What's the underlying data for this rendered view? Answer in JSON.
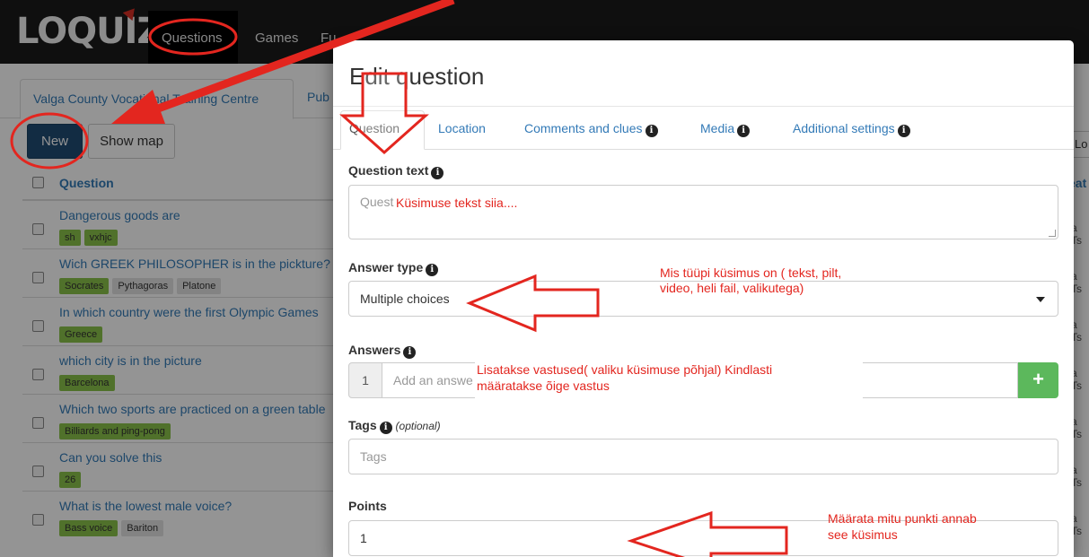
{
  "app": {
    "logo": "LOQUIZ",
    "nav": [
      "Questions",
      "Games",
      "Fu"
    ]
  },
  "background": {
    "tab_active": "Valga County Vocational Training Centre",
    "tab_other": "Pub",
    "new_button": "New",
    "show_map_button": "Show map",
    "column_header": "Question",
    "right_button": "Lo",
    "right_column_header": "eat",
    "right_cell": "a Ts",
    "rows": [
      {
        "question": "Dangerous goods are",
        "tags": [
          "sh",
          "vxhjc"
        ]
      },
      {
        "question": "Wich GREEK PHILOSOPHER is in the pickture?",
        "tags": [
          "Socrates",
          "Pythagoras",
          "Platone"
        ]
      },
      {
        "question": "In which country were the first Olympic Games",
        "tags": [
          "Greece"
        ]
      },
      {
        "question": "which city is in the picture",
        "tags": [
          "Barcelona"
        ]
      },
      {
        "question": "Which two sports are practiced on a green table",
        "tags": [
          "Billiards and ping-pong"
        ]
      },
      {
        "question": "Can you solve this",
        "tags": [
          "26"
        ]
      },
      {
        "question": "What is the lowest male voice?",
        "tags": [
          "Bass voice",
          "Bariton"
        ]
      }
    ]
  },
  "modal": {
    "title": "Edit question",
    "tabs": [
      "Question",
      "Location",
      "Comments and clues",
      "Media",
      "Additional settings"
    ],
    "question_text_label": "Question text",
    "question_text_placeholder": "Quest",
    "answer_type_label": "Answer type",
    "answer_type_value": "Multiple choices",
    "answers_label": "Answers",
    "answer_number": "1",
    "answer_placeholder": "Add an answe",
    "add_answer_icon": "+",
    "tags_label": "Tags",
    "tags_optional": "(optional)",
    "tags_placeholder": "Tags",
    "points_label": "Points",
    "points_value": "1",
    "info_icon_glyph": "i"
  },
  "annotations": {
    "question_text_note": "Küsimuse tekst siia....",
    "answer_type_note_line1": "Mis tüüpi küsimus on ( tekst, pilt,",
    "answer_type_note_line2": "video, heli fail, valikutega)",
    "answers_note_line1": "Lisatakse vastused( valiku küsimuse põhjal) Kindlasti",
    "answers_note_line2": "määratakse õige vastus",
    "points_note_line1": "Määrata mitu punkti annab",
    "points_note_line2": "see küsimus",
    "color": "#e3261f"
  }
}
